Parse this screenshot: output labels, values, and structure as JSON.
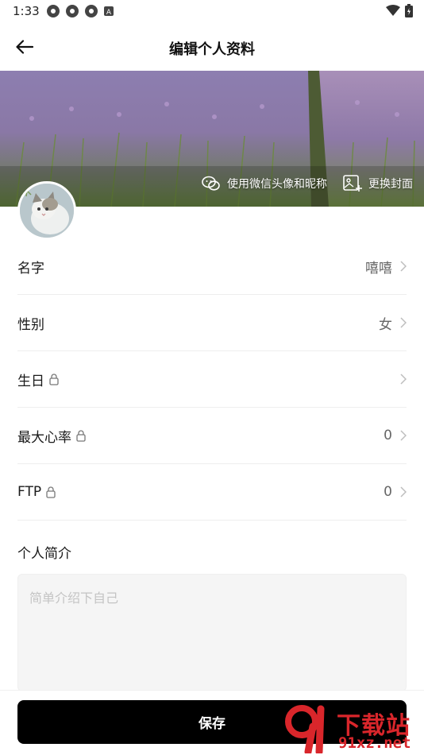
{
  "status_bar": {
    "time": "1:33"
  },
  "header": {
    "title": "编辑个人资料"
  },
  "cover": {
    "wechat_label": "使用微信头像和昵称",
    "change_cover_label": "更换封面"
  },
  "fields": {
    "name": {
      "label": "名字",
      "value": "嘻嘻"
    },
    "gender": {
      "label": "性别",
      "value": "女"
    },
    "birthday": {
      "label": "生日",
      "value": ""
    },
    "max_hr": {
      "label": "最大心率",
      "value": "0"
    },
    "ftp": {
      "label": "FTP",
      "value": "0"
    }
  },
  "bio": {
    "title": "个人简介",
    "placeholder": "简单介绍下自己"
  },
  "save_label": "保存",
  "watermark": {
    "big": "下载站",
    "small": "91xz.net"
  },
  "colors": {
    "accent": "#000000",
    "watermark": "#d9262b",
    "divider": "#eeeeee"
  }
}
